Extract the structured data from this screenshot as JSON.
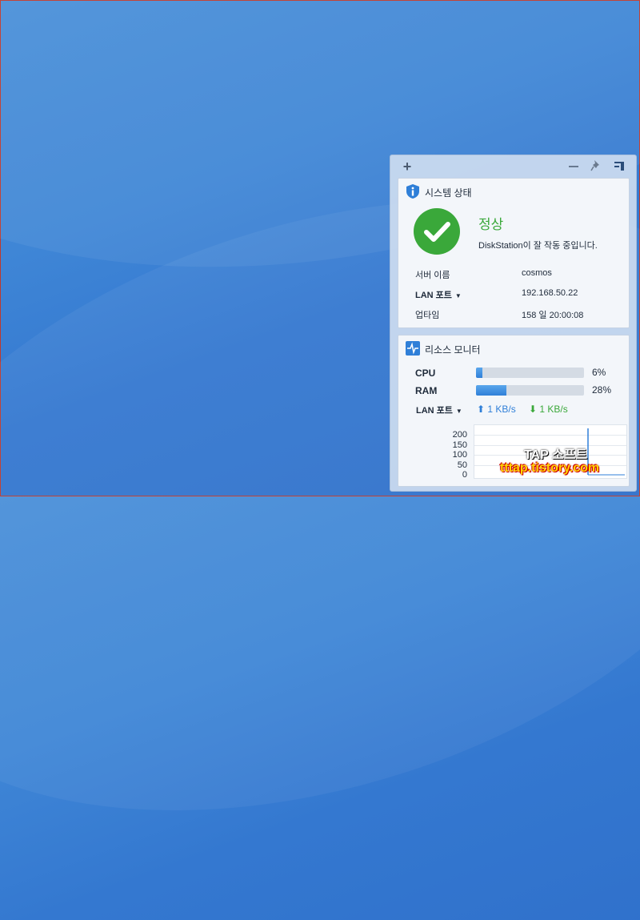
{
  "toolbar": {
    "icons": [
      "plus-icon",
      "minimize-icon",
      "pin-icon",
      "layout-icon"
    ]
  },
  "system_status": {
    "title": "시스템 상태",
    "status": "정상",
    "description": "DiskStation이 잘 작동 중입니다.",
    "rows": [
      {
        "label": "서버 이름",
        "value": "cosmos"
      },
      {
        "label": "LAN 포트",
        "value": "192.168.50.22"
      },
      {
        "label": "업타임",
        "value": "158 일 20:00:08"
      }
    ],
    "colors": {
      "ok": "#3aa83a",
      "info": "#2f7fd8"
    }
  },
  "resource_monitor": {
    "title": "리소스 모니터",
    "cpu": {
      "label": "CPU",
      "percent": 6,
      "percent_text": "6%"
    },
    "ram": {
      "label": "RAM",
      "percent": 28,
      "percent_text": "28%"
    },
    "lan": {
      "label": "LAN 포트",
      "upload": "1 KB/s",
      "download": "1 KB/s",
      "upload_color": "#2f7fd8",
      "download_color": "#3aa83a"
    },
    "chart_yticks": [
      "200",
      "150",
      "100",
      "50",
      "0"
    ]
  },
  "watermark": {
    "line1": "TAP 소프트",
    "line2": "tttap.tistory.com"
  }
}
